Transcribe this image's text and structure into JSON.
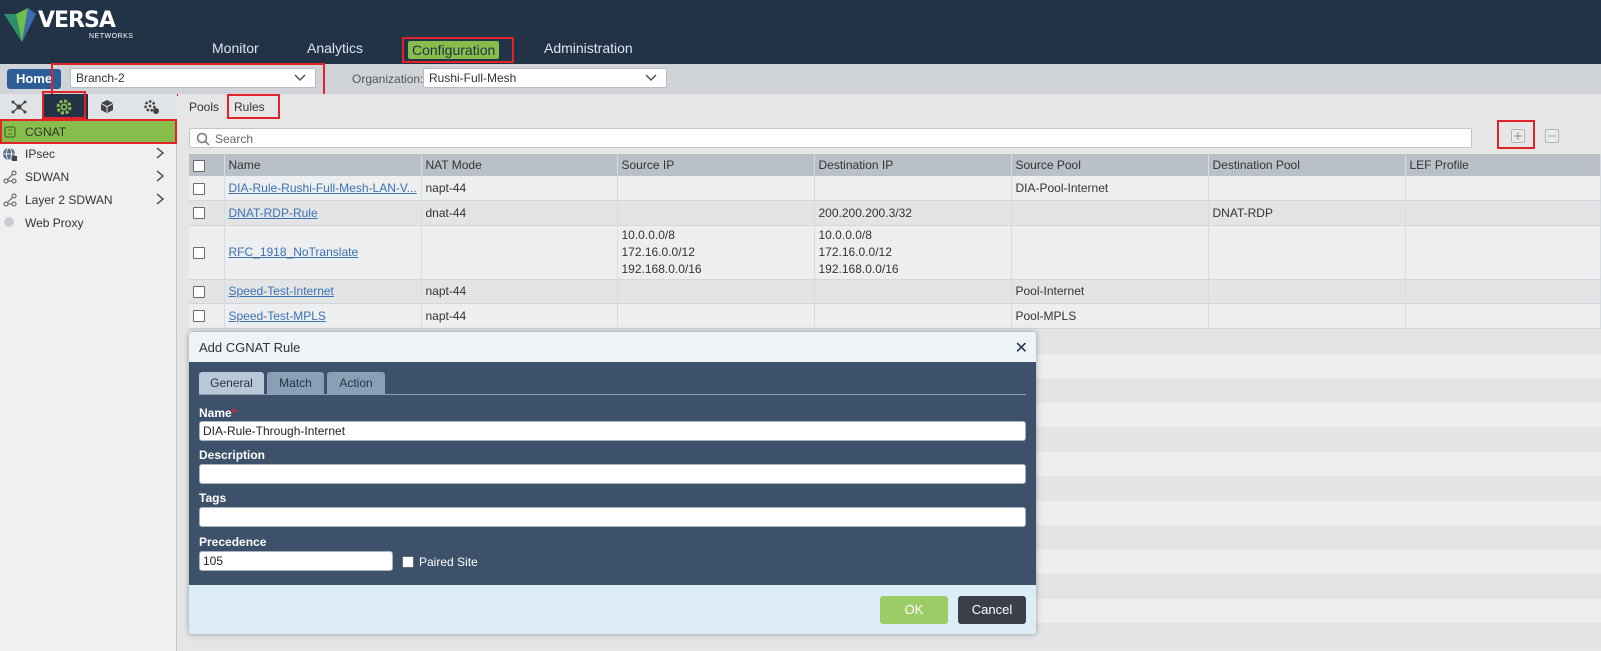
{
  "brand": {
    "name": "VERSA",
    "sub": "NETWORKS"
  },
  "nav": {
    "monitor": "Monitor",
    "analytics": "Analytics",
    "configuration": "Configuration",
    "administration": "Administration"
  },
  "context": {
    "home": "Home",
    "appliance": "Branch-2",
    "org_label": "Organization:",
    "org_value": "Rushi-Full-Mesh"
  },
  "sidebar": {
    "tab_icons": [
      "network-icon",
      "gear-icon",
      "cube-icon",
      "gear-network-icon"
    ],
    "items": [
      {
        "label": "CGNAT",
        "icon": "nat-icon"
      },
      {
        "label": "IPsec",
        "icon": "globe-icon"
      },
      {
        "label": "SDWAN",
        "icon": "branch-icon"
      },
      {
        "label": "Layer 2 SDWAN",
        "icon": "branch-icon"
      },
      {
        "label": "Web Proxy",
        "icon": "proxy-icon"
      }
    ]
  },
  "subtabs": {
    "pools": "Pools",
    "rules": "Rules"
  },
  "search": {
    "placeholder": "Search"
  },
  "table": {
    "columns": [
      "Name",
      "NAT Mode",
      "Source IP",
      "Destination IP",
      "Source Pool",
      "Destination Pool",
      "LEF Profile"
    ],
    "rows": [
      {
        "name": "DIA-Rule-Rushi-Full-Mesh-LAN-V...",
        "mode": "napt-44",
        "src": "",
        "dst": "",
        "spool": "DIA-Pool-Internet",
        "dpool": "",
        "lef": ""
      },
      {
        "name": "DNAT-RDP-Rule",
        "mode": "dnat-44",
        "src": "",
        "dst": "200.200.200.3/32",
        "spool": "",
        "dpool": "DNAT-RDP",
        "lef": ""
      },
      {
        "name": "RFC_1918_NoTranslate",
        "mode": "",
        "src": [
          "10.0.0.0/8",
          "172.16.0.0/12",
          "192.168.0.0/16"
        ],
        "dst": [
          "10.0.0.0/8",
          "172.16.0.0/12",
          "192.168.0.0/16"
        ],
        "spool": "",
        "dpool": "",
        "lef": ""
      },
      {
        "name": "Speed-Test-Internet",
        "mode": "napt-44",
        "src": "",
        "dst": "",
        "spool": "Pool-Internet",
        "dpool": "",
        "lef": ""
      },
      {
        "name": "Speed-Test-MPLS",
        "mode": "napt-44",
        "src": "",
        "dst": "",
        "spool": "Pool-MPLS",
        "dpool": "",
        "lef": ""
      }
    ]
  },
  "modal": {
    "title": "Add CGNAT Rule",
    "tabs": {
      "general": "General",
      "match": "Match",
      "action": "Action"
    },
    "name_label": "Name",
    "required_mark": "*",
    "name_value": "DIA-Rule-Through-Internet",
    "description_label": "Description",
    "description_value": "",
    "tags_label": "Tags",
    "tags_value": "",
    "precedence_label": "Precedence",
    "precedence_value": "105",
    "paired_site_label": "Paired Site",
    "paired_site_checked": false,
    "ok": "OK",
    "cancel": "Cancel"
  },
  "colors": {
    "header_bg": "#233347",
    "accent_green": "#87bd4a",
    "highlight_red": "#e3232a",
    "link_blue": "#3b73b3",
    "modal_body_bg": "#3d526a"
  }
}
